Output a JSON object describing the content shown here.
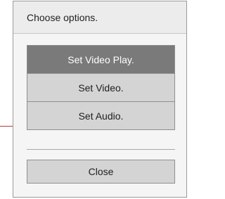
{
  "dialog": {
    "title": "Choose options.",
    "options": [
      {
        "label": "Set Video Play.",
        "selected": true
      },
      {
        "label": "Set Video.",
        "selected": false
      },
      {
        "label": "Set Audio.",
        "selected": false
      }
    ],
    "close_label": "Close"
  },
  "colors": {
    "selected_bg": "#7a7a7a",
    "option_bg": "#d4d4d4",
    "accent_line": "#b23a3a"
  }
}
